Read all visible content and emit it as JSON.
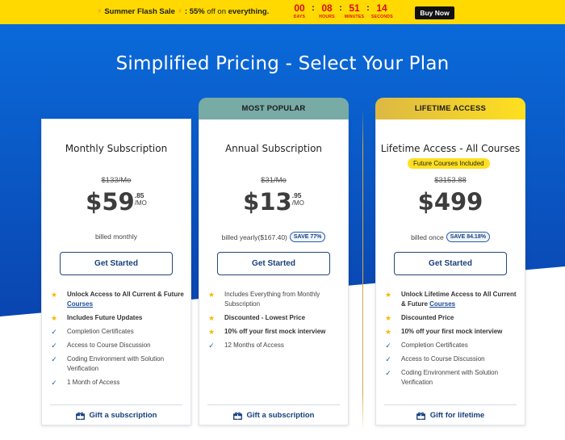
{
  "banner": {
    "bolt": "⚡",
    "event": "Summer Flash Sale",
    "pct": ": 55%",
    "rest": "off on",
    "tail": "everything.",
    "timer": [
      {
        "value": "00",
        "label": "DAYS"
      },
      {
        "value": "08",
        "label": "HOURS"
      },
      {
        "value": "51",
        "label": "MINUTES"
      },
      {
        "value": "14",
        "label": "SECONDS"
      }
    ],
    "separator": ":",
    "buy_label": "Buy Now"
  },
  "page": {
    "title": "Simplified Pricing - Select Your Plan"
  },
  "plans": [
    {
      "name": "Monthly Subscription",
      "old_price": "$133/Mo",
      "price_main": "$59",
      "price_cents": ".85",
      "price_per": "/MO",
      "billed": "billed monthly",
      "cta": "Get Started",
      "features": [
        {
          "icon": "star",
          "text": "Unlock Access to All Current & Future ",
          "link": "Courses"
        },
        {
          "icon": "star",
          "text": "Includes Future Updates"
        },
        {
          "icon": "check",
          "text": "Completion Certificates"
        },
        {
          "icon": "check",
          "text": "Access to Course Discussion"
        },
        {
          "icon": "check",
          "text": "Coding Environment with Solution Verification"
        },
        {
          "icon": "check",
          "text": "1 Month of Access"
        }
      ],
      "gift": "Gift a subscription"
    },
    {
      "header": "MOST POPULAR",
      "name": "Annual Subscription",
      "old_price": "$31/Mo",
      "price_main": "$13",
      "price_cents": ".95",
      "price_per": "/MO",
      "billed": "billed yearly($167.40)",
      "save": "SAVE 77%",
      "cta": "Get Started",
      "features": [
        {
          "icon": "star",
          "text": "Includes Everything from Monthly Subscription"
        },
        {
          "icon": "star",
          "text": "Discounted - Lowest Price"
        },
        {
          "icon": "star",
          "text": "10% off your first mock interview"
        },
        {
          "icon": "check",
          "text": "12 Months of Access"
        }
      ],
      "gift": "Gift a subscription"
    },
    {
      "header": "LIFETIME ACCESS",
      "name": "Lifetime Access - All Courses",
      "badge": "Future Courses Included",
      "old_price": "$3153.88",
      "price_main": "$499",
      "billed": "billed once",
      "save": "SAVE 84.18%",
      "cta": "Get Started",
      "features": [
        {
          "icon": "star",
          "text": "Unlock Lifetime Access to All Current & Future ",
          "link": "Courses"
        },
        {
          "icon": "star",
          "text": "Discounted Price"
        },
        {
          "icon": "star",
          "text": "10% off your first mock interview"
        },
        {
          "icon": "check",
          "text": "Completion Certificates"
        },
        {
          "icon": "check",
          "text": "Access to Course Discussion"
        },
        {
          "icon": "check",
          "text": "Coding Environment with Solution Verification"
        }
      ],
      "gift": "Gift for lifetime"
    }
  ],
  "colors": {
    "banner_bg": "#ffd900",
    "hero_blue": "#0a64d6",
    "brand_navy": "#17407d",
    "popular_head": "#78aaa6",
    "lifetime_head": "#ffe01e",
    "timer_red": "#d60d0d"
  }
}
